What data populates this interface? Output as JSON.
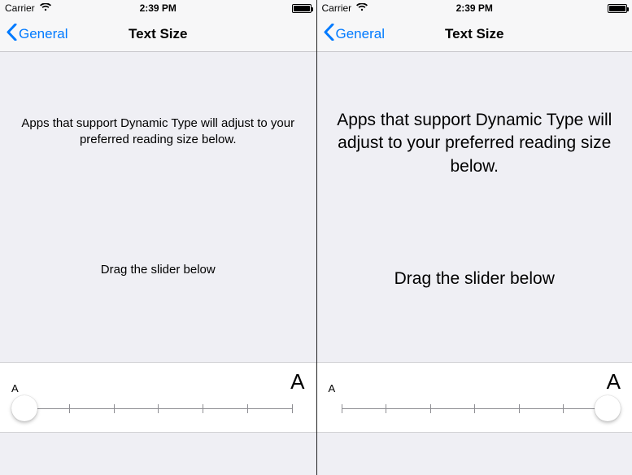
{
  "panes": [
    {
      "side": "left",
      "status": {
        "carrier": "Carrier",
        "time": "2:39 PM"
      },
      "nav": {
        "back_label": "General",
        "title": "Text Size"
      },
      "description": "Apps that support Dynamic Type will adjust to your preferred reading size below.",
      "hint": "Drag the slider below",
      "slider": {
        "min_label": "A",
        "max_label": "A",
        "steps": 7,
        "value_index": 0
      }
    },
    {
      "side": "right",
      "status": {
        "carrier": "Carrier",
        "time": "2:39 PM"
      },
      "nav": {
        "back_label": "General",
        "title": "Text Size"
      },
      "description": "Apps that support Dynamic Type will adjust to your preferred reading size below.",
      "hint": "Drag the slider below",
      "slider": {
        "min_label": "A",
        "max_label": "A",
        "steps": 7,
        "value_index": 6
      }
    }
  ],
  "colors": {
    "tint": "#007aff",
    "bg": "#efeff4",
    "panel": "#ffffff",
    "hairline": "#c8c7cc"
  }
}
